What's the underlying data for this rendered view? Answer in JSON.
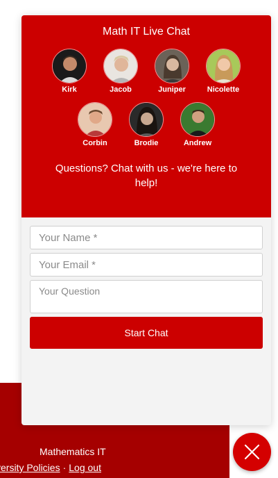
{
  "footer": {
    "department": "Mathematics IT",
    "links": [
      {
        "label": "versity Policies"
      },
      {
        "label": "Log out"
      }
    ],
    "separator": "·"
  },
  "chat": {
    "title": "Math IT Live Chat",
    "agents": [
      {
        "name": "Kirk",
        "icon": "avatar-kirk"
      },
      {
        "name": "Jacob",
        "icon": "avatar-jacob"
      },
      {
        "name": "Juniper",
        "icon": "avatar-juniper"
      },
      {
        "name": "Nicolette",
        "icon": "avatar-nicolette"
      },
      {
        "name": "Corbin",
        "icon": "avatar-corbin"
      },
      {
        "name": "Brodie",
        "icon": "avatar-brodie"
      },
      {
        "name": "Andrew",
        "icon": "avatar-andrew"
      }
    ],
    "tagline": "Questions? Chat with us - we're here to help!",
    "form": {
      "name_placeholder": "Your Name *",
      "email_placeholder": "Your Email *",
      "question_placeholder": "Your Question",
      "submit_label": "Start Chat"
    },
    "close_icon": "close-icon"
  },
  "colors": {
    "header_red": "#cc0000",
    "footer_red": "#a50000",
    "fab_red": "#d40000"
  }
}
